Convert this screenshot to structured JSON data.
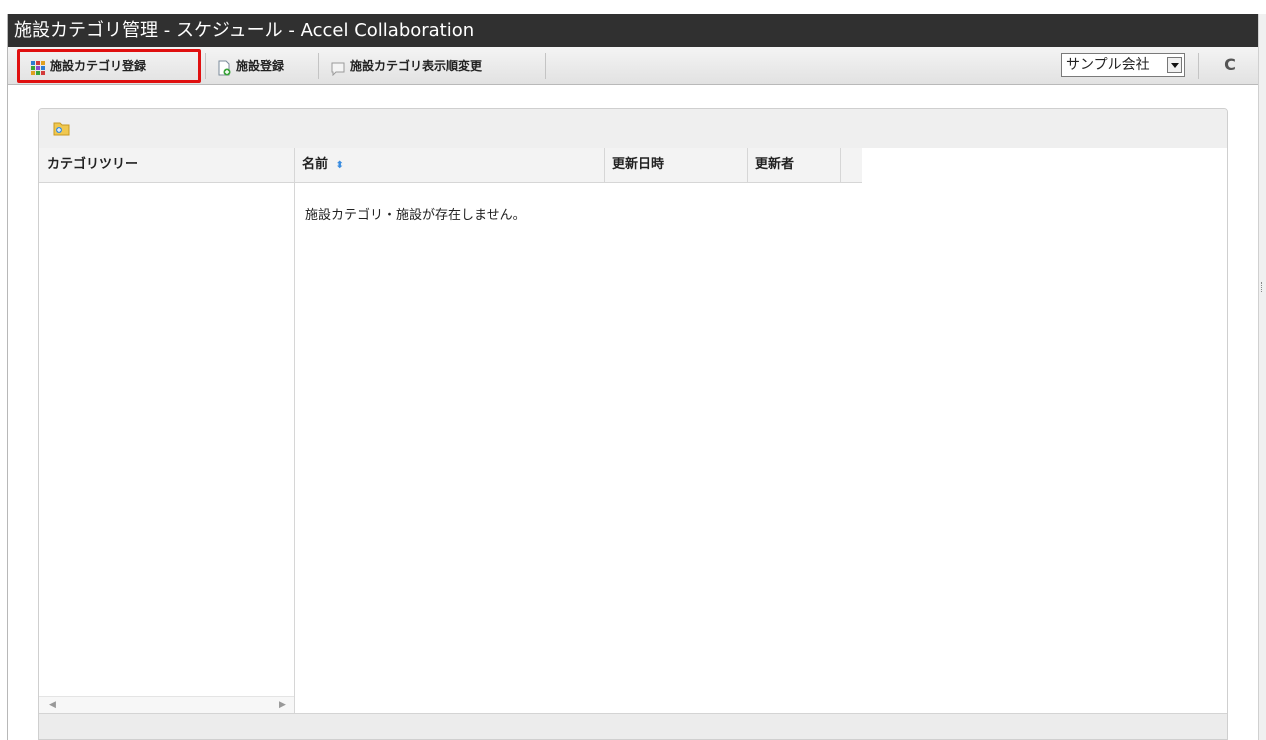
{
  "window": {
    "title": "施設カテゴリ管理 - スケジュール - Accel Collaboration"
  },
  "toolbar": {
    "buttons": [
      {
        "label": "施設カテゴリ登録",
        "icon": "grid-icon"
      },
      {
        "label": "施設登録",
        "icon": "document-add-icon"
      },
      {
        "label": "施設カテゴリ表示順変更",
        "icon": "sort-order-icon"
      }
    ],
    "company_select": {
      "value": "サンプル会社"
    },
    "refresh_icon": "C"
  },
  "panel": {
    "columns": {
      "tree": "カテゴリツリー",
      "name": "名前",
      "sort_indicator": "⬍",
      "updated_at": "更新日時",
      "updated_by": "更新者"
    },
    "empty_message": "施設カテゴリ・施設が存在しません。",
    "scroll_left": "◀",
    "scroll_right": "▶"
  },
  "colors": {
    "titlebar": "#303030",
    "highlight": "#e01010"
  }
}
